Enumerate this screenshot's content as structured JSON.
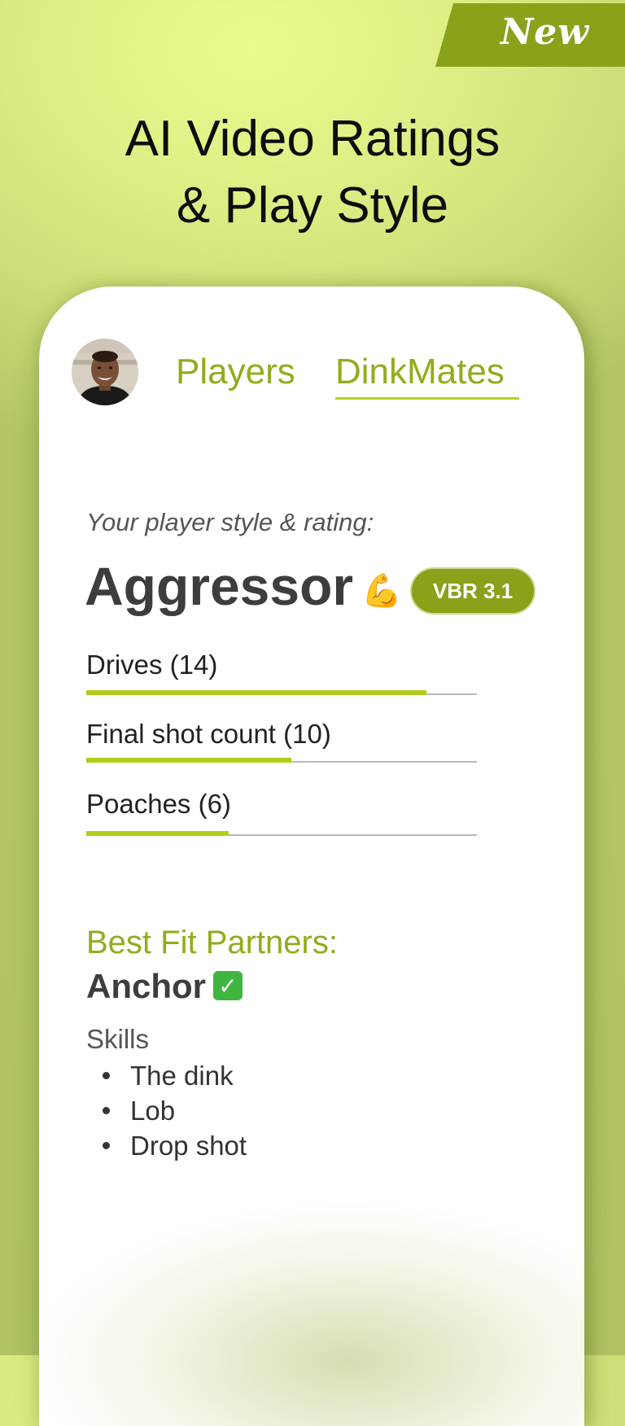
{
  "ribbon": {
    "label": "New"
  },
  "headline": {
    "line1": "AI Video Ratings",
    "line2": "& Play Style"
  },
  "nav": {
    "tabs": [
      {
        "label": "Players",
        "active": false
      },
      {
        "label": "DinkMates",
        "active": true
      }
    ]
  },
  "profile": {
    "style_label": "Your player style & rating:",
    "style_name": "Aggressor",
    "style_emoji": "💪",
    "rating_badge": "VBR 3.1"
  },
  "stats": [
    {
      "label": "Drives (14)",
      "fraction": 0.87
    },
    {
      "label": "Final shot count (10)",
      "fraction": 0.525
    },
    {
      "label": "Poaches (6)",
      "fraction": 0.365
    }
  ],
  "partners": {
    "heading": "Best Fit Partners:",
    "name": "Anchor",
    "check_icon": "✓",
    "skills_heading": "Skills",
    "skills": [
      "The dink",
      "Lob",
      "Drop shot"
    ]
  },
  "colors": {
    "accent": "#93ab1d",
    "badge": "#8aa21a",
    "progress": "#b4cd1d"
  }
}
